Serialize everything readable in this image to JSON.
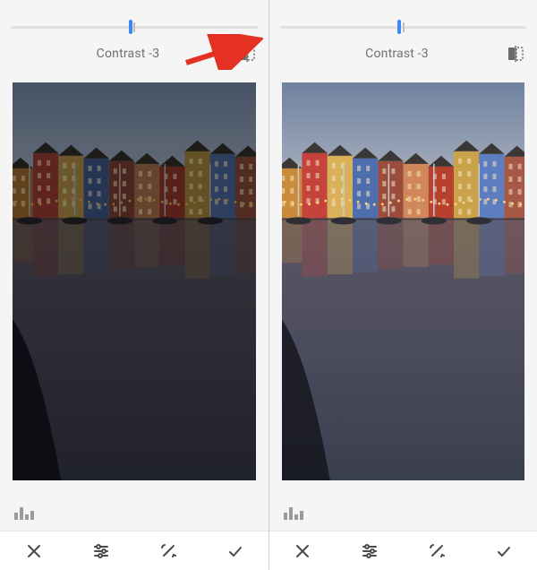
{
  "panels": [
    {
      "slider": {
        "min": -100,
        "max": 100,
        "value": -3
      },
      "adjustment_label": "Contrast -3",
      "show_arrow_to_compare": true,
      "image_variant": "before"
    },
    {
      "slider": {
        "min": -100,
        "max": 100,
        "value": -3
      },
      "adjustment_label": "Contrast -3",
      "show_arrow_to_compare": false,
      "image_variant": "after"
    }
  ],
  "icons": {
    "compare": "compare-before-after-icon",
    "histogram": "histogram-icon",
    "cancel": "close-icon",
    "adjust": "tune-icon",
    "magic": "auto-fix-icon",
    "confirm": "check-icon"
  },
  "colors": {
    "accent": "#4285f4",
    "arrow": "#e53124"
  }
}
